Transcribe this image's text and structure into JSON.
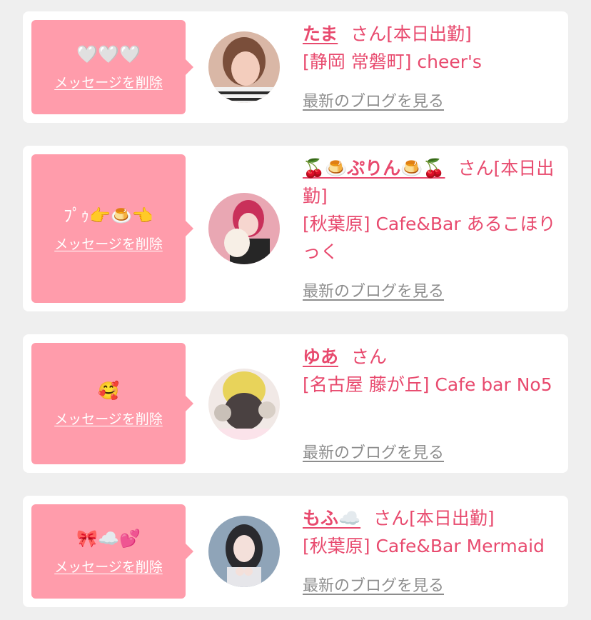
{
  "delete_label": "メッセージを削除",
  "blog_label": "最新のブログを見る",
  "entries": [
    {
      "name": "たま",
      "honorific": "さん[本日出勤]",
      "shop": "[静岡 常磐町] cheer's",
      "message": "🤍🤍🤍"
    },
    {
      "name": "🍒🍮ぷりん🍮🍒",
      "honorific": "さん[本日出勤]",
      "shop": "[秋葉原] Cafe&Bar あるこほりっく",
      "message": "ﾌﾟｩ👉🍮👈"
    },
    {
      "name": "ゆあ",
      "honorific": "さん",
      "shop": "[名古屋 藤が丘] Cafe bar No5",
      "message": "🥰"
    },
    {
      "name": "もふ☁️",
      "honorific": "さん[本日出勤]",
      "shop": "[秋葉原] Cafe&Bar Mermaid",
      "message": "🎀☁️💕"
    }
  ],
  "colors": {
    "background": "#efefef",
    "card": "#ffffff",
    "bubble": "#ff9cab",
    "accent": "#e84a6e",
    "link_gray": "#8d8d8d"
  }
}
